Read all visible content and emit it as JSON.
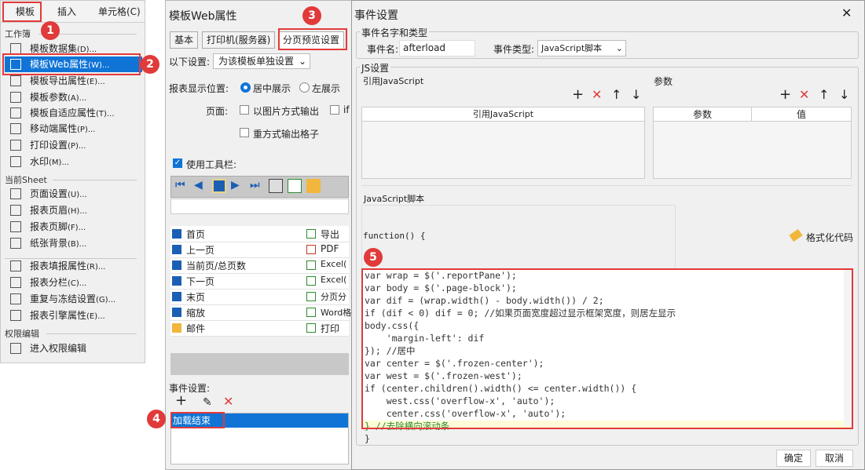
{
  "menu": {
    "tabs": [
      "模板",
      "插入",
      "单元格(C)"
    ],
    "section_workbook": "工作簿",
    "section_sheet": "当前Sheet",
    "section_perm": "权限编辑",
    "workbook_items": [
      {
        "label": "模板数据集",
        "shortcut": "(D)..."
      },
      {
        "label": "模板Web属性",
        "shortcut": "(W)..."
      },
      {
        "label": "模板导出属性",
        "shortcut": "(E)..."
      },
      {
        "label": "模板参数",
        "shortcut": "(A)..."
      },
      {
        "label": "模板自适应属性",
        "shortcut": "(T)..."
      },
      {
        "label": "移动端属性",
        "shortcut": "(P)..."
      },
      {
        "label": "打印设置",
        "shortcut": "(P)..."
      },
      {
        "label": "水印",
        "shortcut": "(M)..."
      }
    ],
    "sheet_items": [
      {
        "label": "页面设置",
        "shortcut": "(U)..."
      },
      {
        "label": "报表页眉",
        "shortcut": "(H)..."
      },
      {
        "label": "报表页脚",
        "shortcut": "(F)..."
      },
      {
        "label": "纸张背景",
        "shortcut": "(B)..."
      },
      {
        "label": "报表填报属性",
        "shortcut": "(R)..."
      },
      {
        "label": "报表分栏",
        "shortcut": "(C)..."
      },
      {
        "label": "重复与冻结设置",
        "shortcut": "(G)..."
      },
      {
        "label": "报表引擎属性",
        "shortcut": "(E)..."
      }
    ],
    "perm_item": "进入权限编辑"
  },
  "web": {
    "title": "模板Web属性",
    "tabs": [
      "基本",
      "打印机(服务器)",
      "分页预览设置"
    ],
    "settings_label": "以下设置:",
    "settings_value": "为该模板单独设置",
    "display_pos_label": "报表显示位置:",
    "center_label": "居中展示",
    "left_label": "左展示",
    "page_label": "页面:",
    "as_image_label": "以图片方式输出",
    "if_label": "if",
    "reassign_label": "重方式输出格子",
    "toolbar_label": "使用工具栏:",
    "buttons_left": [
      "首页",
      "上一页",
      "当前页/总页数",
      "下一页",
      "末页",
      "缩放",
      "邮件"
    ],
    "buttons_right": [
      "导出",
      "PDF",
      "Excel(",
      "Excel(",
      "分页分",
      "Word格",
      "打印"
    ],
    "event_label": "事件设置:",
    "event_item": "加载结束"
  },
  "dialog": {
    "title": "事件设置",
    "group_name": "事件名字和类型",
    "name_label": "事件名:",
    "name_value": "afterload",
    "type_label": "事件类型:",
    "type_value": "JavaScript脚本",
    "js_group": "JS设置",
    "ref_js_label": "引用JavaScript",
    "param_label": "参数",
    "ref_js_header": "引用JavaScript",
    "param_header": "参数",
    "value_header": "值",
    "script_label": "JavaScript脚本",
    "func_header": "function() {",
    "format_label": "格式化代码",
    "code_lines": [
      "var wrap = $('.reportPane');",
      "var body = $('.page-block');",
      "var dif = (wrap.width() - body.width()) / 2;",
      "if (dif < 0) dif = 0; //如果页面宽度超过显示框架宽度，则居左显示",
      "body.css({",
      "    'margin-left': dif",
      "}); //居中",
      "var center = $('.frozen-center');",
      "var west = $('.frozen-west');",
      "if (center.children().width() <= center.width()) {",
      "    west.css('overflow-x', 'auto');",
      "    center.css('overflow-x', 'auto');",
      "} //去除横向滚动条",
      "}"
    ],
    "ok_label": "确定",
    "cancel_label": "取消"
  },
  "badges": [
    "1",
    "2",
    "3",
    "4",
    "5"
  ],
  "colors": {
    "accent": "#0f74d6",
    "highlight": "#e23a3a"
  }
}
